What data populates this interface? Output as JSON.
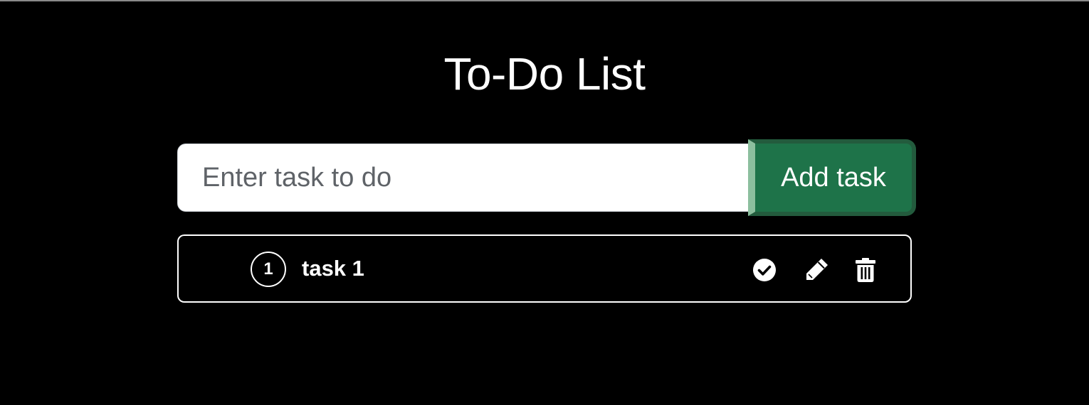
{
  "header": {
    "title": "To-Do List"
  },
  "form": {
    "input_value": "",
    "input_placeholder": "Enter task to do",
    "add_button_label": "Add task"
  },
  "tasks": [
    {
      "number": "1",
      "text": "task 1",
      "actions": [
        "check-circle-icon",
        "pencil-icon",
        "trash-icon"
      ]
    }
  ],
  "colors": {
    "background": "#000000",
    "accent": "#1e7349",
    "text": "#ffffff"
  }
}
